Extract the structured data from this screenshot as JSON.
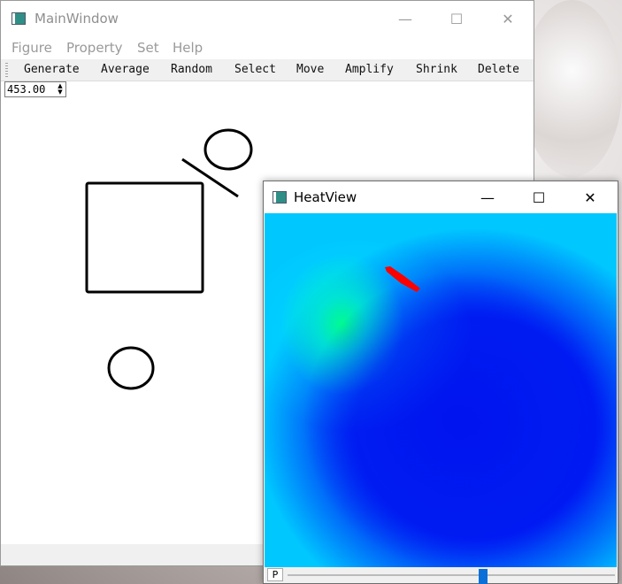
{
  "main_window": {
    "title": "MainWindow",
    "menu": [
      "Figure",
      "Property",
      "Set",
      "Help"
    ],
    "toolbar": [
      "Generate",
      "Average",
      "Random",
      "Select",
      "Move",
      "Amplify",
      "Shrink",
      "Delete"
    ],
    "spinbox_value": "453.00"
  },
  "heat_window": {
    "title": "HeatView",
    "p_button": "P",
    "slider_value": 0.6
  },
  "controls": {
    "minimize": "—",
    "maximize": "☐",
    "close": "✕"
  },
  "colors": {
    "shape_stroke": "#000000",
    "hot_marker": "#ff0000",
    "slider_handle": "#0a6fd6"
  },
  "icons": [
    "app-icon",
    "minimize-icon",
    "maximize-icon",
    "close-icon",
    "spin-up-icon",
    "spin-down-icon"
  ]
}
